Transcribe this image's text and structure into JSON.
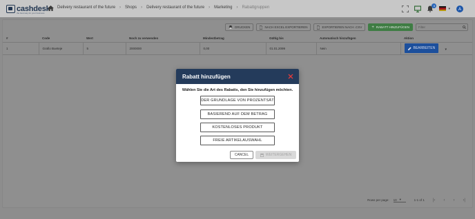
{
  "app": {
    "logo_text": "cashdesk",
    "logo_sub": "the best way for your business"
  },
  "breadcrumb": [
    "Delivery restaurant of the future",
    "Shops",
    "Delivery restaurant of the future",
    "Marketing",
    "Rabattgruppen"
  ],
  "topbar": {
    "notification_count": "0",
    "avatar_letter": "A"
  },
  "toolbar": {
    "print_label": "Drucken",
    "excel_label": "Nach Excel exportieren",
    "csv_label": "Exportieren nach .csv",
    "add_label": "Rabatt hinzufügen",
    "search_placeholder": "Filter"
  },
  "table": {
    "columns": [
      "#",
      "Code",
      "Wert",
      "Noch zu verwenden",
      "Mindestbetrag",
      "Gültig bis",
      "Automatisch hinzufügen",
      "Aktion"
    ],
    "rows": [
      [
        "1",
        "Grafio Bueteje",
        "5",
        "2000000",
        "0,00",
        "01.01.2099",
        "Nein"
      ]
    ],
    "edit_label": "Bearbeiten"
  },
  "pager": {
    "rows_label": "Rows per page:",
    "rows_value": "10",
    "range": "1-1 of 1"
  },
  "modal": {
    "title": "Rabatt hinzufügen",
    "question": "Wählen Sie die Art des Rabatts, den Sie hinzufügen möchten.",
    "options": [
      "der Grundlage von Prozentsät",
      "Basierend auf dem Betrag",
      "Kostenloses Produkt",
      "Freie Artikelauswahl"
    ],
    "cancel_label": "Cancel",
    "next_label": "Weitergehen"
  },
  "colors": {
    "header": "#243b5b",
    "close": "#e03b3b",
    "primary": "#1c4f9c",
    "green": "#3f7d44"
  }
}
